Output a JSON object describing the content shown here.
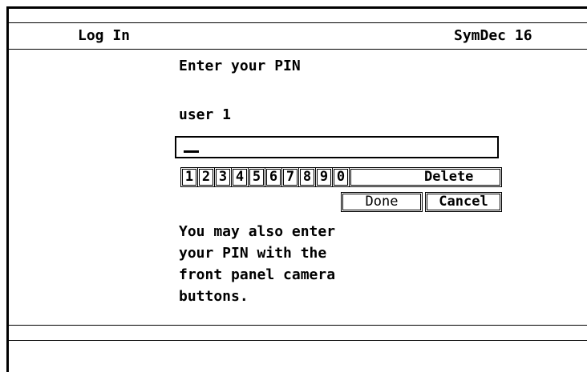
{
  "header": {
    "title": "Log In",
    "device": "SymDec 16"
  },
  "prompt": "Enter your PIN",
  "user_label": "user 1",
  "pin_input": {
    "value": ""
  },
  "keypad": {
    "digits": [
      "1",
      "2",
      "3",
      "4",
      "5",
      "6",
      "7",
      "8",
      "9",
      "0"
    ],
    "delete_label": "Delete",
    "done_label": "Done",
    "cancel_label": "Cancel"
  },
  "help_lines": [
    "You may also enter",
    "your PIN with the",
    "front panel camera",
    "buttons."
  ]
}
